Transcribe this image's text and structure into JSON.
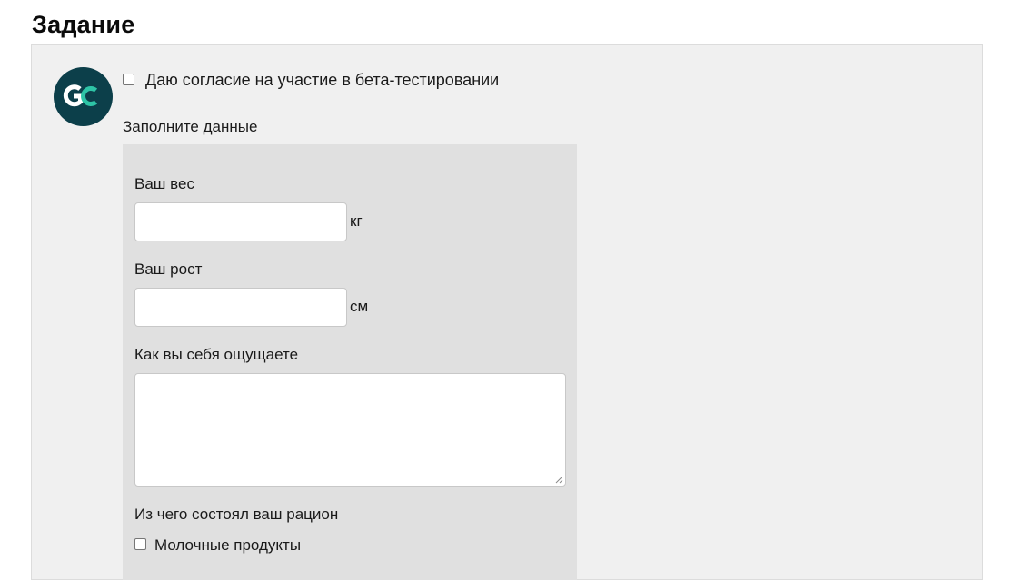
{
  "page": {
    "title": "Задание"
  },
  "task": {
    "avatar_text": "GC",
    "consent": {
      "label": "Даю согласие на участие в бета-тестировании",
      "checked": false
    },
    "fill_data_label": "Заполните данные",
    "form": {
      "weight": {
        "label": "Ваш вес",
        "value": "",
        "unit": "кг"
      },
      "height": {
        "label": "Ваш рост",
        "value": "",
        "unit": "см"
      },
      "feeling": {
        "label": "Как вы себя ощущаете",
        "value": ""
      },
      "diet": {
        "label": "Из чего состоял ваш рацион",
        "options": [
          {
            "label": "Молочные продукты",
            "checked": false
          }
        ]
      }
    }
  },
  "colors": {
    "avatar_bg": "#0c3f4a",
    "avatar_accent": "#2ec4a6",
    "panel_bg": "#f0f0f0",
    "form_bg": "#e0e0e0"
  }
}
